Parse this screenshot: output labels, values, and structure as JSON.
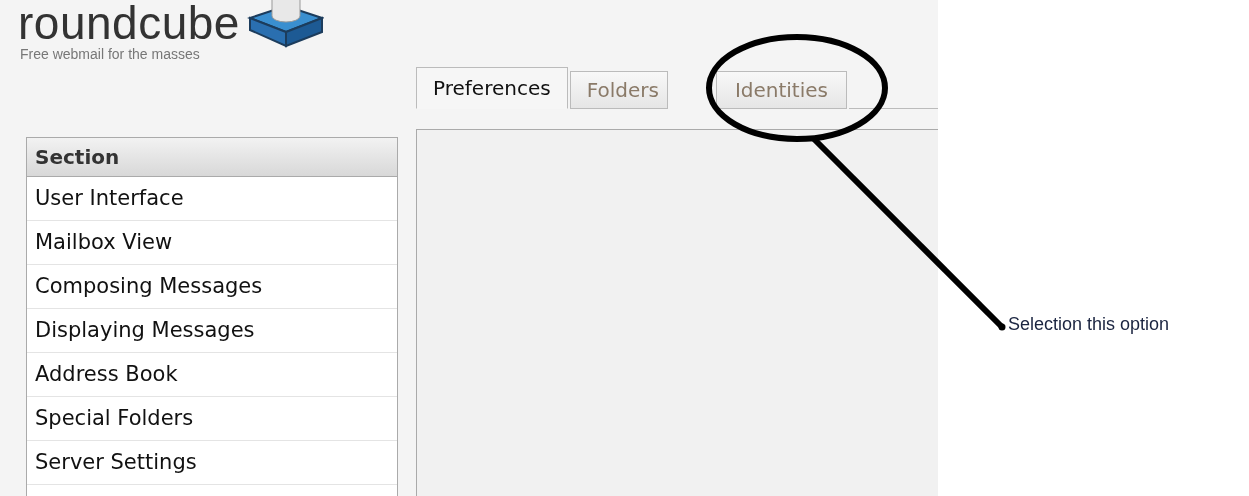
{
  "logo": {
    "name": "roundcube",
    "tagline": "Free webmail for the masses"
  },
  "tabs": [
    {
      "label": "Preferences",
      "selected": true
    },
    {
      "label": "Folders",
      "selected": false
    },
    {
      "label": "Identities",
      "selected": false
    }
  ],
  "sidebar": {
    "header": "Section",
    "items": [
      {
        "label": "User Interface",
        "selected": false
      },
      {
        "label": "Mailbox View",
        "selected": false
      },
      {
        "label": "Composing Messages",
        "selected": false
      },
      {
        "label": "Displaying Messages",
        "selected": false
      },
      {
        "label": "Address Book",
        "selected": false
      },
      {
        "label": "Special Folders",
        "selected": false
      },
      {
        "label": "Server Settings",
        "selected": false
      }
    ]
  },
  "annotation": {
    "text": "Selection this option"
  }
}
